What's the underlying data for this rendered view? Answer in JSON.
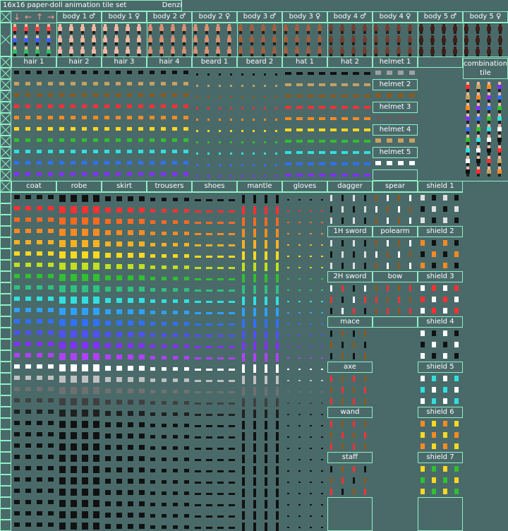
{
  "title": "16x16 paper-doll animation tile set",
  "author": "Denzi",
  "direction_arrows": [
    "down",
    "left",
    "up",
    "right"
  ],
  "body_labels": [
    "body 1 ♂",
    "body 1 ♀",
    "body 2 ♂",
    "body 2 ♀",
    "body 3 ♂",
    "body 3 ♀",
    "body 4 ♂",
    "body 4 ♀",
    "body 5 ♂",
    "body 5 ♀"
  ],
  "head_labels": [
    "hair 1",
    "hair 2",
    "hair 3",
    "hair 4",
    "beard 1",
    "beard 2",
    "hat 1",
    "hat 2",
    "helmet 1"
  ],
  "helmet_labels": [
    "helmet 2",
    "helmet 3",
    "helmet 4",
    "helmet 5"
  ],
  "combination_label": "combination tile",
  "clothing_labels": [
    "coat",
    "robe",
    "skirt",
    "trousers",
    "shoes",
    "mantle",
    "gloves",
    "dagger",
    "spear",
    "shield 1"
  ],
  "weapon_labels": [
    "1H sword",
    "polearm",
    "2H sword",
    "bow",
    "mace",
    "axe",
    "wand",
    "staff"
  ],
  "shield_labels": [
    "shield 2",
    "shield 3",
    "shield 4",
    "shield 5",
    "shield 6",
    "shield 7"
  ],
  "palette": [
    "#111111",
    "#c8a060",
    "#8a5a20",
    "#ff3030",
    "#ff8a20",
    "#ffd820",
    "#30c030",
    "#30e0e0",
    "#3070ff",
    "#8030ff",
    "#ffffff",
    "#202020"
  ],
  "skin_tones": [
    "#f0b8a0",
    "#d89070",
    "#a06040",
    "#704030",
    "#402018"
  ]
}
